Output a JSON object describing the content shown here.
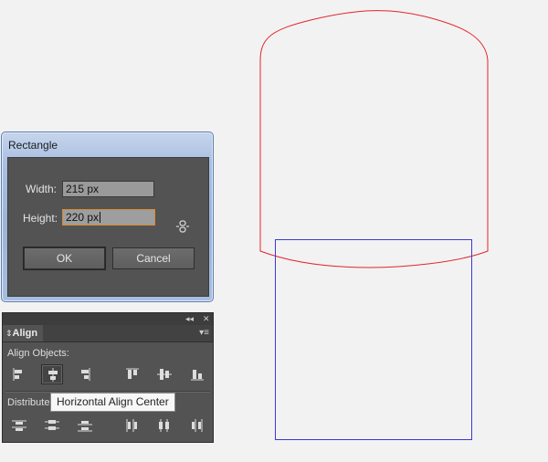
{
  "dialog": {
    "title": "Rectangle",
    "width_label": "Width:",
    "width_value": "215 px",
    "height_label": "Height:",
    "height_value": "220 px",
    "ok_label": "OK",
    "cancel_label": "Cancel",
    "link_icon": "constrain-proportions-icon"
  },
  "align_panel": {
    "collapse_glyph": "◂◂",
    "close_glyph": "✕",
    "tab_label": "Align",
    "tab_glyph": "⇕",
    "align_objects_label": "Align Objects:",
    "distribute_label": "Distribute O",
    "tooltip": "Horizontal Align Center",
    "menu_glyph": "▾≡"
  },
  "artboard": {
    "red_shape_color": "#e2262b",
    "blue_rect_color": "#3a3ad4"
  }
}
